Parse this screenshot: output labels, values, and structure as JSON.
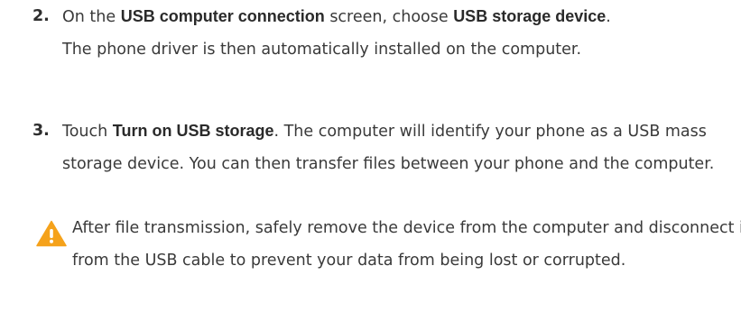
{
  "steps": [
    {
      "number": "2.",
      "pre": "On the ",
      "bold1": "USB computer connection",
      "mid": " screen, choose ",
      "bold2": "USB storage device",
      "post": ".",
      "line2": "The phone driver is then automatically installed on the computer."
    },
    {
      "number": "3.",
      "pre": "Touch ",
      "bold1": "Turn on USB storage",
      "post": ". The computer will identify your phone as a USB mass storage device. You can then transfer files between your phone and the computer."
    }
  ],
  "note": {
    "icon": "warning-icon",
    "text": "After file transmission, safely remove the device from the computer and disconnect it from the USB cable to prevent your data from being lost or corrupted."
  },
  "colors": {
    "text": "#3a3a3a",
    "warning": "#f5a21b"
  }
}
